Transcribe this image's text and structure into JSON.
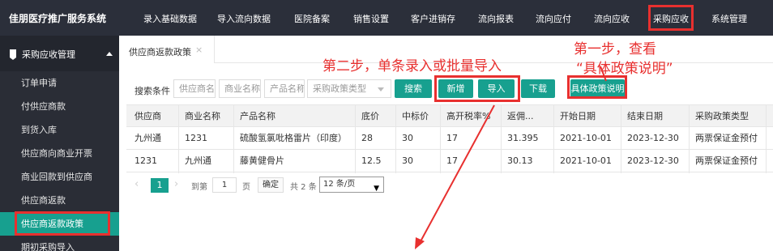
{
  "header": {
    "brand": "佳朋医疗推广服务系统",
    "nav": [
      "录入基础数据",
      "导入流向数据",
      "医院备案",
      "销售设置",
      "客户进销存",
      "流向报表",
      "流向应付",
      "流向应收",
      "采购应收",
      "系统管理"
    ],
    "active_nav": "采购应收"
  },
  "sidebar": {
    "section": "采购应收管理",
    "items": [
      "订单申请",
      "付供应商款",
      "到货入库",
      "供应商向商业开票",
      "商业回款到供应商",
      "供应商返款",
      "供应商返款政策",
      "期初采购导入"
    ],
    "active_item": "供应商返款政策"
  },
  "tab": {
    "label": "供应商返款政策",
    "close": "×"
  },
  "search": {
    "label": "搜索条件",
    "supplier_placeholder": "供应商名称",
    "business_placeholder": "商业名称",
    "product_placeholder": "产品名称",
    "policy_type_placeholder": "采购政策类型"
  },
  "buttons": {
    "search": "搜索",
    "add": "新增",
    "import": "导入",
    "download": "下载",
    "policy_detail": "具体政策说明"
  },
  "table": {
    "columns": [
      "供应商",
      "商业名称",
      "产品名称",
      "底价",
      "中标价",
      "高开税率%",
      "返佣...",
      "开始日期",
      "结束日期",
      "采购政策类型"
    ],
    "rows": [
      [
        "九州通",
        "1231",
        "硫酸氢氯吡格雷片（印度）",
        "28",
        "30",
        "17",
        "31.395",
        "2021-10-01",
        "2023-12-30",
        "两票保证金预付"
      ],
      [
        "1231",
        "九州通",
        "藤黄健骨片",
        "12.5",
        "30",
        "17",
        "30.13",
        "2021-10-01",
        "2023-12-30",
        "两票保证金预付"
      ]
    ]
  },
  "pager": {
    "prev": "‹",
    "current": "1",
    "next": "›",
    "goto_label": "到第",
    "goto_value": "1",
    "page_label": "页",
    "confirm": "确定",
    "total": "共 2 条",
    "page_size": "12 条/页"
  },
  "annotations": {
    "step1_line1": "第一步，查看",
    "step1_line2": "“具体政策说明”",
    "step2": "第二步，单条录入或批量导入"
  },
  "colors": {
    "accent": "#17a08f",
    "annotation": "#e8302f",
    "topbar": "#2b2f3a",
    "sidebar": "#2a2d36"
  }
}
